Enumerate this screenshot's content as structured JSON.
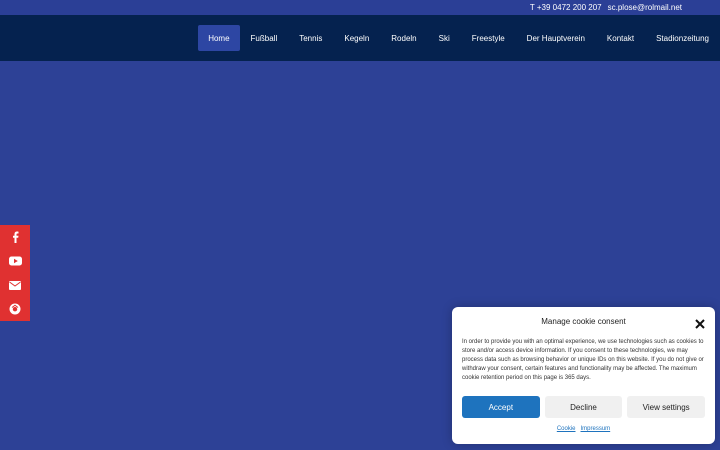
{
  "topbar": {
    "phone": "T +39 0472 200 207",
    "email": "sc.plose@rolmail.net"
  },
  "nav": {
    "items": [
      {
        "label": "Home",
        "active": true
      },
      {
        "label": "Fußball"
      },
      {
        "label": "Tennis"
      },
      {
        "label": "Kegeln"
      },
      {
        "label": "Rodeln"
      },
      {
        "label": "Ski"
      },
      {
        "label": "Freestyle"
      },
      {
        "label": "Der Hauptverein"
      },
      {
        "label": "Kontakt"
      },
      {
        "label": "Stadionzeitung"
      }
    ]
  },
  "social": {
    "icons": [
      "facebook-icon",
      "youtube-icon",
      "email-icon",
      "instagram-icon"
    ],
    "color": "#e03131"
  },
  "cookie": {
    "title": "Manage cookie consent",
    "text": "In order to provide you with an optimal experience, we use technologies such as cookies to store and/or access device information. If you consent to these technologies, we may process data such as browsing behavior or unique IDs on this website. If you do not give or withdraw your consent, certain features and functionality may be affected. The maximum cookie retention period on this page is 365 days.",
    "accept": "Accept",
    "decline": "Decline",
    "settings": "View settings",
    "link_cookie": "Cookie",
    "link_impressum": "Impressum"
  },
  "colors": {
    "page_bg": "#2d4196",
    "nav_bg": "#05224f",
    "nav_active": "#2d46a3",
    "accept": "#1e73be"
  }
}
